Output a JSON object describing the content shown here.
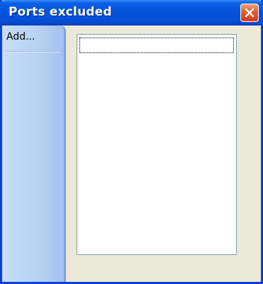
{
  "window": {
    "title": "Ports excluded",
    "close_icon": "close-icon"
  },
  "sidebar": {
    "items": [
      {
        "label": "Add..."
      }
    ]
  },
  "ports_list": {
    "items": []
  },
  "colors": {
    "titlebar": "#0453dc",
    "close_button": "#e45a2c",
    "sidebar": "#b8d1f3",
    "window_background": "#ece9d8"
  }
}
